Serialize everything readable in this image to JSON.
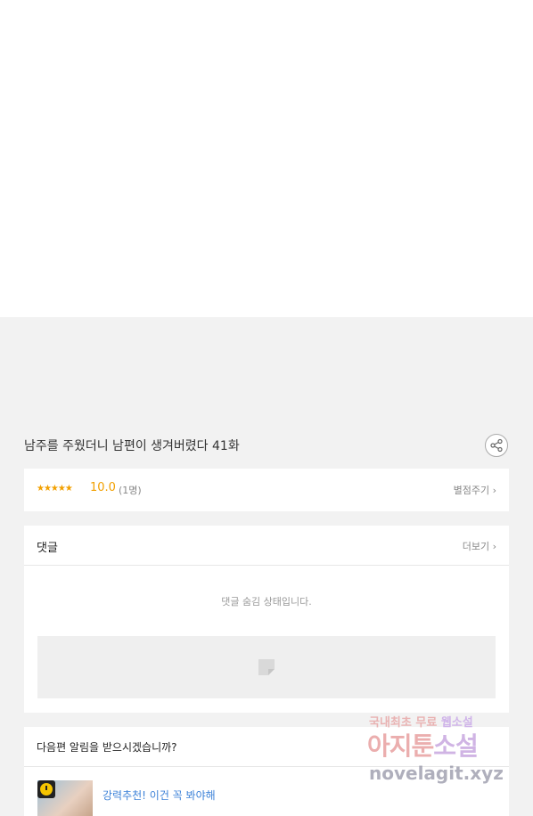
{
  "episode": {
    "title": "남주를 주웠더니 남편이 생겨버렸다 41화"
  },
  "rating": {
    "stars": "★★★★★",
    "score": "10.0",
    "count": "(1명)",
    "rate_link": "별점주기 ›"
  },
  "comments": {
    "title": "댓글",
    "more_link": "더보기 ›",
    "hidden_message": "댓글 숨김 상태입니다."
  },
  "notify": {
    "title": "다음편 알림을 받으시겠습니까?",
    "recommend": "강력추천! 이건 꼭 봐야해"
  },
  "watermark": {
    "line1_a": "국내최초 무료 ",
    "line1_b": "웹소설",
    "line2_a": "아지툰",
    "line2_b": "소설",
    "line3": "novelagit.xyz"
  },
  "colors": {
    "accent_star": "#f2a000",
    "link_blue": "#3d82d8",
    "background": "#f2f2f2"
  },
  "icons": {
    "share": "share-icon",
    "placeholder": "image-placeholder-icon",
    "clock": "clock-icon"
  }
}
